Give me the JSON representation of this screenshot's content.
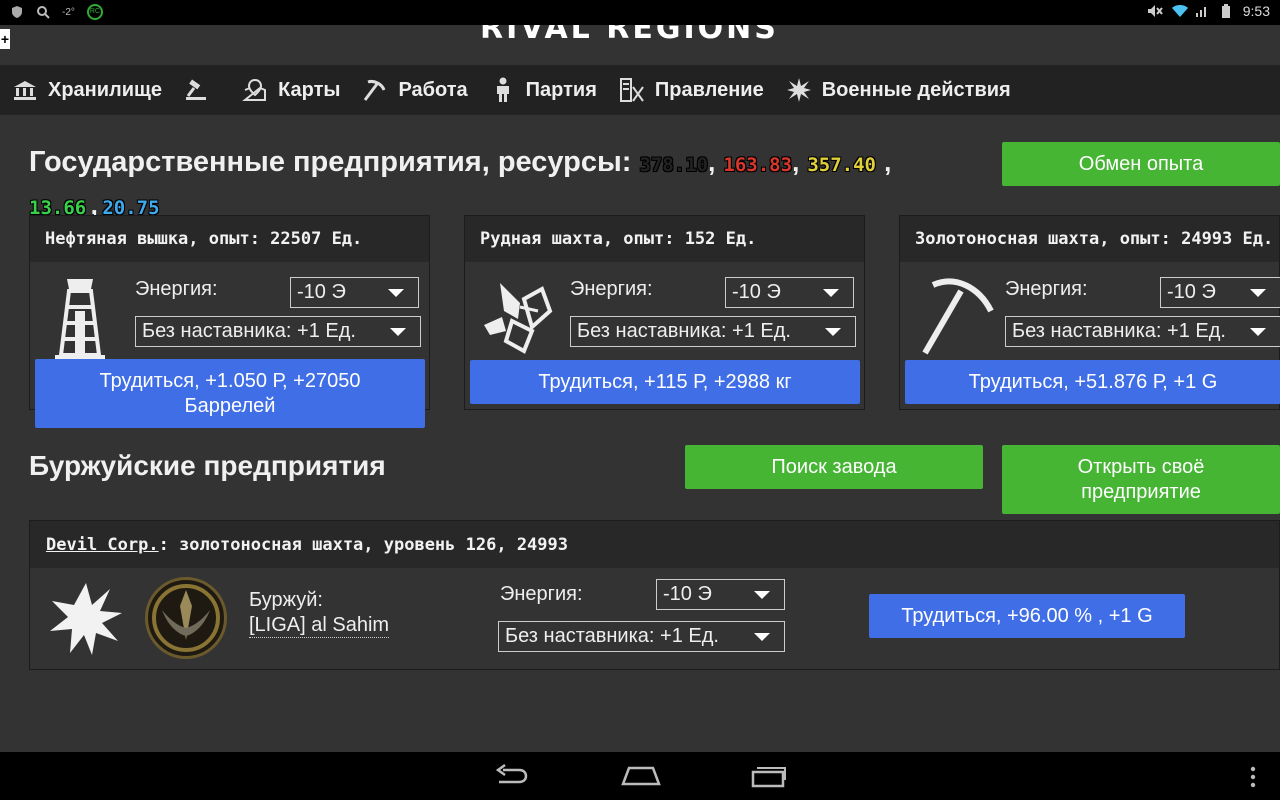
{
  "status_bar": {
    "temperature": "-2°",
    "badge": "RC",
    "time": "9:53"
  },
  "header": {
    "cut_title": "RIVAL REGIONS",
    "corner_glyph": "+"
  },
  "nav": {
    "items": [
      {
        "label": "Хранилище",
        "icon": "bank-icon"
      },
      {
        "label": "",
        "icon": "gavel-icon"
      },
      {
        "label": "Карты",
        "icon": "map-icon"
      },
      {
        "label": "Работа",
        "icon": "pickaxe-icon"
      },
      {
        "label": "Партия",
        "icon": "party-icon"
      },
      {
        "label": "Правление",
        "icon": "government-icon"
      },
      {
        "label": "Военные действия",
        "icon": "explosion-icon"
      }
    ]
  },
  "state": {
    "title": "Государственные предприятия, ресурсы:",
    "resources": [
      {
        "value": "378.10",
        "color": "#222222"
      },
      {
        "value": "163.83",
        "color": "#d9372b"
      },
      {
        "value": "357.40",
        "color": "#e0d03a"
      },
      {
        "value": "13.66",
        "color": "#38d14a"
      },
      {
        "value": "20.75",
        "color": "#3fa9ee"
      }
    ],
    "comma": ",",
    "exchange_button": "Обмен опыта"
  },
  "cards": [
    {
      "title": "Нефтяная вышка, опыт: 22507 Ед.",
      "icon": "oil-rig-icon",
      "energy_label": "Энергия:",
      "energy_value": "-10 Э",
      "mentor_value": "Без наставника: +1 Ед.",
      "work_button": "Трудиться, +1.050 Р, +27050 Баррелей"
    },
    {
      "title": "Рудная шахта, опыт: 152 Ед.",
      "icon": "ore-icon",
      "energy_label": "Энергия:",
      "energy_value": "-10 Э",
      "mentor_value": "Без наставника: +1 Ед.",
      "work_button": "Трудиться, +115 Р, +2988 кг"
    },
    {
      "title": "Золотоносная шахта, опыт: 24993 Ед.",
      "icon": "pickaxe-icon",
      "energy_label": "Энергия:",
      "energy_value": "-10 Э",
      "mentor_value": "Без наставника: +1 Ед.",
      "work_button": "Трудиться, +51.876 Р, +1 G"
    }
  ],
  "bourgeois": {
    "title": "Буржуйские предприятия",
    "find_button": "Поиск завода",
    "open_button": "Открыть своё предприятие",
    "factory": {
      "corp": "Devil Corp.",
      "rest": ": золотоносная шахта, уровень 126, 24993",
      "owner_label": "Буржуй:",
      "owner_name": "[LIGA] al Sahim",
      "energy_label": "Энергия:",
      "energy_value": "-10 Э",
      "mentor_value": "Без наставника: +1 Ед.",
      "work_button": "Трудиться, +96.00 % , +1 G"
    }
  }
}
